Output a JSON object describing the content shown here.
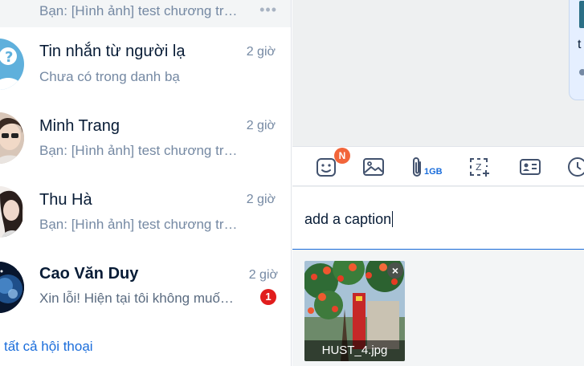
{
  "conversation_list": {
    "partial_item": {
      "preview": "Bạn: [Hình ảnh] test chương trình"
    },
    "items": [
      {
        "name": "Tin nhắn từ người lạ",
        "preview": "Chưa có trong danh bạ",
        "time": "2 giờ",
        "avatar_icon": "stranger-question-icon"
      },
      {
        "name": "Minh Trang",
        "preview": "Bạn: [Hình ảnh] test chương trình",
        "time": "2 giờ",
        "avatar_icon": "user-photo"
      },
      {
        "name": "Thu Hà",
        "preview": "Bạn: [Hình ảnh] test chương trình",
        "time": "2 giờ",
        "avatar_icon": "user-photo"
      },
      {
        "name": "Cao Văn Duy",
        "preview": "Xin lỗi! Hiện tại tôi không muốn nhận tin nhắn",
        "time": "2 giờ",
        "unread": "1",
        "avatar_icon": "user-photo"
      }
    ],
    "view_all": "tất cả hội thoại"
  },
  "chat": {
    "partial_message_text": "t"
  },
  "toolbar": {
    "sticker_badge": "N",
    "file_limit": "1GB",
    "icons": [
      "sticker-icon",
      "image-icon",
      "attach-file-icon",
      "screenshot-icon",
      "contact-card-icon",
      "reminder-clock-icon"
    ]
  },
  "composer": {
    "value": "add a caption"
  },
  "attachment": {
    "filename": "HUST_4.jpg"
  },
  "colors": {
    "accent": "#1a6ddb",
    "unread_badge": "#e11d1d",
    "new_badge": "#f2653a",
    "muted_text": "#7589a3"
  }
}
